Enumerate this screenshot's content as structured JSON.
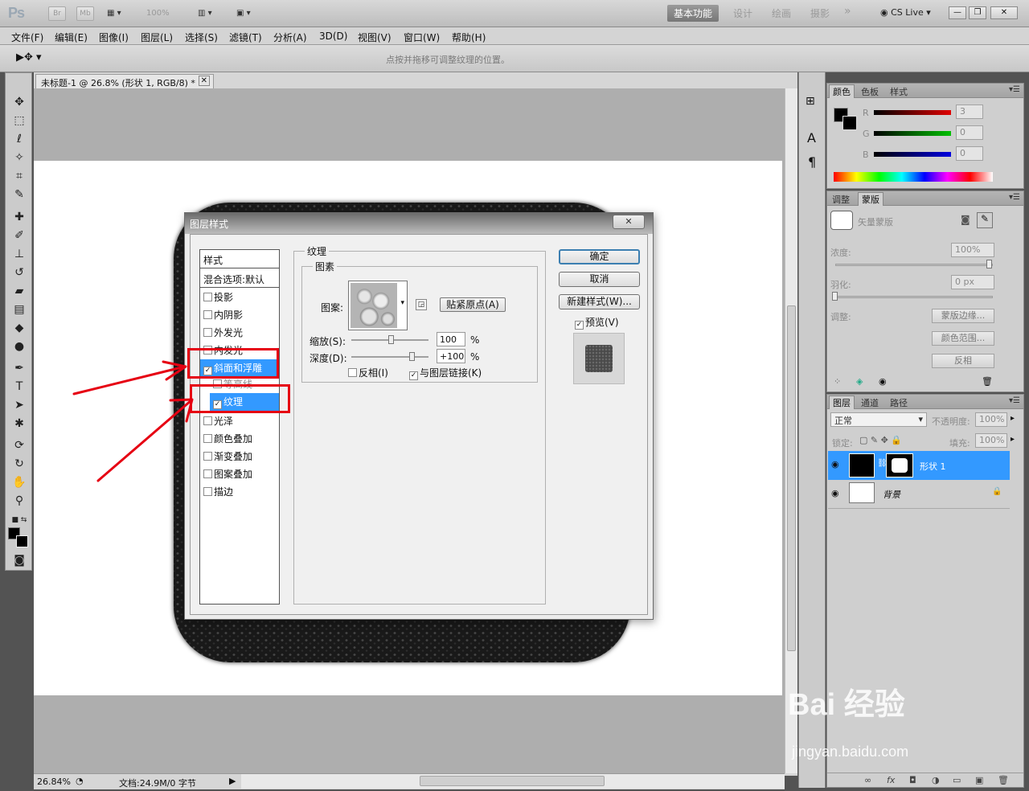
{
  "appbar": {
    "logo": "Ps",
    "bridge": "Br",
    "minibridge": "Mb",
    "zoom": "100%",
    "workspaces": [
      "基本功能",
      "设计",
      "绘画",
      "摄影"
    ],
    "more": "»",
    "cslive": "CS Live",
    "window_controls": [
      "—",
      "❐",
      "✕"
    ]
  },
  "menubar": [
    "文件(F)",
    "编辑(E)",
    "图像(I)",
    "图层(L)",
    "选择(S)",
    "滤镜(T)",
    "分析(A)",
    "3D(D)",
    "视图(V)",
    "窗口(W)",
    "帮助(H)"
  ],
  "optionsbar": {
    "hint": "点按并拖移可调整纹理的位置。"
  },
  "document": {
    "tab_title": "未标题-1 @ 26.8% (形状 1, RGB/8) *",
    "status_zoom": "26.84%",
    "status_doc": "文档:24.9M/0 字节"
  },
  "dialog": {
    "title": "图层样式",
    "styles_header": "样式",
    "blend_options": "混合选项:默认",
    "styles": [
      {
        "label": "投影",
        "checked": false
      },
      {
        "label": "内阴影",
        "checked": false
      },
      {
        "label": "外发光",
        "checked": false
      },
      {
        "label": "内发光",
        "checked": false
      },
      {
        "label": "斜面和浮雕",
        "checked": true
      },
      {
        "label": "等高线",
        "checked": false
      },
      {
        "label": "纹理",
        "checked": true
      },
      {
        "label": "光泽",
        "checked": false
      },
      {
        "label": "颜色叠加",
        "checked": false
      },
      {
        "label": "渐变叠加",
        "checked": false
      },
      {
        "label": "图案叠加",
        "checked": false
      },
      {
        "label": "描边",
        "checked": false
      }
    ],
    "section_title": "纹理",
    "group_title": "图素",
    "pattern_label": "图案:",
    "snap_button": "贴紧原点(A)",
    "scale_label": "缩放(S):",
    "scale_value": "100",
    "depth_label": "深度(D):",
    "depth_value": "+100",
    "percent": "%",
    "invert_label": "反相(I)",
    "invert_checked": false,
    "link_label": "与图层链接(K)",
    "link_checked": true,
    "ok": "确定",
    "cancel": "取消",
    "new_style": "新建样式(W)...",
    "preview_label": "预览(V)",
    "preview_checked": true
  },
  "color_panel": {
    "tabs": [
      "颜色",
      "色板",
      "样式"
    ],
    "channels": [
      {
        "name": "R",
        "value": "3",
        "color": "#e00000"
      },
      {
        "name": "G",
        "value": "0",
        "color": "#00c000"
      },
      {
        "name": "B",
        "value": "0",
        "color": "#0000e0"
      }
    ]
  },
  "mask_panel": {
    "tabs": [
      "调整",
      "蒙版"
    ],
    "mask_type": "矢量蒙版",
    "density_label": "浓度:",
    "density_value": "100%",
    "feather_label": "羽化:",
    "feather_value": "0 px",
    "adjust_label": "调整:",
    "buttons": [
      "蒙版边缘...",
      "颜色范围...",
      "反相"
    ]
  },
  "layers_panel": {
    "tabs": [
      "图层",
      "通道",
      "路径"
    ],
    "blend_mode": "正常",
    "opacity_label": "不透明度:",
    "opacity_value": "100%",
    "lock_label": "锁定:",
    "fill_label": "填充:",
    "fill_value": "100%",
    "layers": [
      {
        "name": "形状 1",
        "selected": true
      },
      {
        "name": "背景",
        "selected": false
      }
    ],
    "footer_icons": [
      "∞",
      "fx",
      "◘",
      "◑",
      "▭",
      "▣",
      "🗑"
    ]
  },
  "watermark": {
    "brand": "Bai 经验",
    "url": "jingyan.baidu.com"
  }
}
